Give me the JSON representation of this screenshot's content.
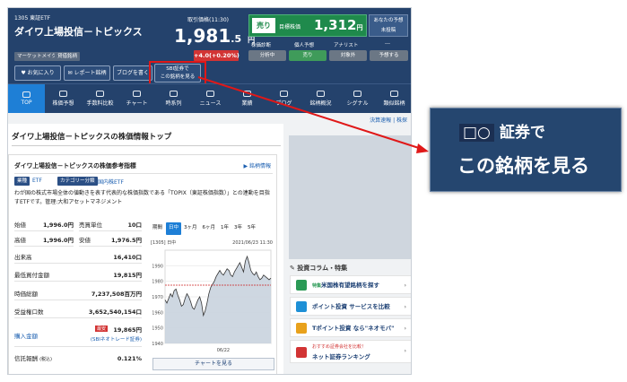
{
  "header": {
    "code": "1305 東証ETF",
    "name": "ダイワ上場投信－トピックス",
    "tags": [
      "マーケットメイク",
      "貸借銘柄"
    ],
    "price_label": "取引価格(11:30)",
    "price": "1,981",
    "price_decimal": ".5",
    "price_unit": "円",
    "change": "+4.0(+0.20%)",
    "sell_label": "売り",
    "target_label": "目標株価",
    "target_price": "1,312",
    "target_unit": "円",
    "eval_line1": "あなたの予想",
    "eval_line2": "未投稿",
    "sub_headers": [
      "株価診断",
      "個人予想",
      "アナリスト",
      "---"
    ],
    "sub_values": [
      "分析中",
      "売り",
      "対象外",
      "予想する"
    ],
    "buttons": [
      "お気に入り",
      "レポート銘柄",
      "ブログを書く"
    ],
    "sbi_line1": "SBI証券で",
    "sbi_line2": "この銘柄を見る"
  },
  "nav": [
    "TOP",
    "株価予想",
    "手数料比較",
    "チャート",
    "時系列",
    "ニュース",
    "業績",
    "ブログ",
    "銘柄概況",
    "シグナル",
    "類似銘柄"
  ],
  "main": {
    "settlement": "決算速報 | 株探",
    "page_title": "ダイワ上場投信－トピックスの株価情報トップ",
    "section_title": "ダイワ上場投信－トピックスの株価参考指標",
    "stock_info_link": "▶ 銘柄情報",
    "industry_label": "業種",
    "industry_value": "ETF",
    "category_label": "カテゴリー分類",
    "category_value": "国内株ETF",
    "description": "わが国の株式市場全体の値動きを表す代表的な株価指数である「TOPIX（東証株価指数）」との連動を目指すETFです。管理:大和アセットマネジメント",
    "left_rows": [
      {
        "label": "始値",
        "value": "1,996.0円"
      },
      {
        "label": "高値",
        "value": "1,996.0円"
      }
    ],
    "right_rows": [
      {
        "label": "売買単位",
        "value": "10口"
      },
      {
        "label": "安値",
        "value": "1,976.5円"
      }
    ],
    "rows": [
      {
        "label": "出来高",
        "value": "16,410口"
      },
      {
        "label": "最低買付金額",
        "value": "19,815円"
      },
      {
        "label": "時価総額",
        "value": "7,237,508百万円"
      },
      {
        "label": "受益権口数",
        "value": "3,652,540,154口"
      }
    ],
    "buy_label": "購入金額",
    "buy_badge": "最安",
    "buy_value": "19,865円",
    "buy_sub": "(SBIネオトレード証券)",
    "fee_label": "信託報酬",
    "fee_note": "(税込)",
    "fee_value": "0.121%",
    "chart_tabs": [
      "期間",
      "日中",
      "3ヶ月",
      "6ヶ月",
      "1年",
      "3年",
      "5年"
    ],
    "chart_corner": "[1305] 日中",
    "chart_date": "2021/06/23 11:30",
    "chart_date_label": "06/22",
    "chart_button": "チャートを見る",
    "column_title": "投資コラム・特集",
    "column_items": [
      {
        "prefix": "特集",
        "text": "米国株有望銘柄を探す"
      },
      {
        "prefix": "",
        "text": "ポイント投資 サービスを比較"
      },
      {
        "prefix": "",
        "text": "Tポイント投資 なら\"ネオモバ\""
      },
      {
        "prefix": "おすすめ証券会社を比較！",
        "text": "ネット証券ランキング"
      }
    ]
  },
  "zoom": {
    "line1_suffix": "証券で",
    "line2": "この銘柄を見る"
  },
  "chart_data": {
    "type": "line",
    "ylim": [
      1940,
      2000
    ],
    "yticks": [
      1940,
      1950,
      1960,
      1970,
      1980,
      1990
    ],
    "values": [
      1968,
      1966,
      1969,
      1972,
      1970,
      1974,
      1975,
      1971,
      1968,
      1964,
      1965,
      1969,
      1972,
      1970,
      1967,
      1963,
      1962,
      1965,
      1968,
      1970,
      1966,
      1958,
      1961,
      1966,
      1972,
      1976,
      1978,
      1980,
      1983,
      1985,
      1987,
      1985,
      1984,
      1986,
      1988,
      1987,
      1984,
      1983,
      1986,
      1988,
      1990,
      1992,
      1989,
      1986,
      1993,
      1996,
      1992,
      1987,
      1985,
      1984,
      1986,
      1983,
      1981,
      1982,
      1984,
      1983,
      1982,
      1981,
      1982
    ],
    "reference": 1977.5,
    "colors": {
      "line": "#333333",
      "fill": "#c9d3de",
      "reference": "#cc2222"
    }
  }
}
